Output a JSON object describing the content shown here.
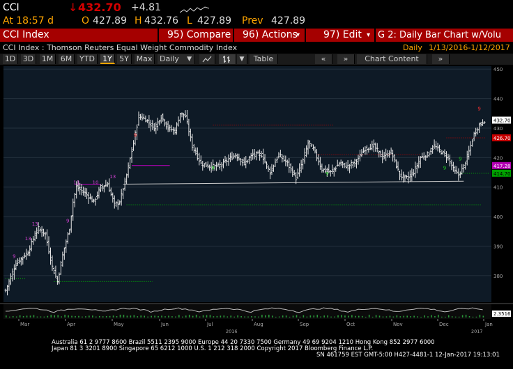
{
  "quote": {
    "ticker": "CCI",
    "arrow": "↓",
    "last": "432.70",
    "change": "+4.81",
    "time_label": "At 18:57 d",
    "open_label": "O",
    "open": "427.89",
    "high_label": "H",
    "high": "432.76",
    "low_label": "L",
    "low": "427.89",
    "prev_label": "Prev",
    "prev": "427.89"
  },
  "menubar": {
    "security": "CCI Index",
    "compare": "95) Compare",
    "actions": "96) Actions",
    "edit": "97) Edit",
    "chart_title": "G 2: Daily Bar Chart w/Volu"
  },
  "subtitle": {
    "text": "CCI Index : Thomson Reuters Equal Weight Commodity Index",
    "frequency": "Daily",
    "range": "1/13/2016-1/12/2017"
  },
  "toolbar": {
    "periods": [
      "1D",
      "3D",
      "1M",
      "6M",
      "YTD",
      "1Y",
      "5Y",
      "Max"
    ],
    "active_period": "1Y",
    "frequency": "Daily",
    "table_label": "Table",
    "chart_content_label": "Chart Content"
  },
  "colors": {
    "background": "#000000",
    "plot_bg": "#0e1a26",
    "bars": "#e6e6e6",
    "menubar": "#a50000",
    "last_price_tag": "#ffffff",
    "red_tag": "#c80000",
    "magenta_tag": "#b400b4",
    "green_tag": "#00a000",
    "accent": "#ffa500"
  },
  "footer": {
    "line1": "Australia 61 2 9777 8600  Brazil 5511 2395 9000  Europe 44 20 7330 7500  Germany 49 69 9204 1210  Hong Kong 852 2977 6000",
    "line2": "Japan 81 3 3201 8900        Singapore 65 6212 1000        U.S. 1 212 318 2000          Copyright 2017 Bloomberg Finance L.P.",
    "line3": "SN 461759 EST  GMT-5:00 H427-4481-1 12-Jan-2017 19:13:01"
  },
  "chart_data": {
    "type": "bar",
    "title": "",
    "xlabel": "",
    "ylabel": "",
    "ylim": [
      371,
      451
    ],
    "y_ticks": [
      "450",
      "440",
      "430",
      "420",
      "410",
      "400",
      "390",
      "380"
    ],
    "x_ticks": [
      "Mar",
      "Apr",
      "May",
      "Jun",
      "Jul",
      "Aug",
      "Sep",
      "Oct",
      "Nov",
      "Dec",
      "Jan"
    ],
    "year_labels": [
      "2016",
      "2017"
    ],
    "price_tags": [
      {
        "label": "432.70",
        "value": 432.7,
        "color": "white"
      },
      {
        "label": "426.70",
        "value": 426.7,
        "color": "red"
      },
      {
        "label": "417.28",
        "value": 417.3,
        "color": "magenta"
      },
      {
        "label": "414.70",
        "value": 414.7,
        "color": "green"
      }
    ],
    "volume_tag": "2.3516",
    "anchors": [
      [
        0,
        375
      ],
      [
        6,
        384
      ],
      [
        13,
        388
      ],
      [
        17,
        394
      ],
      [
        19,
        396
      ],
      [
        23,
        394
      ],
      [
        27,
        383
      ],
      [
        30,
        378
      ],
      [
        33,
        387
      ],
      [
        37,
        396
      ],
      [
        39,
        405
      ],
      [
        41,
        410
      ],
      [
        46,
        408
      ],
      [
        51,
        405
      ],
      [
        55,
        410
      ],
      [
        59,
        411
      ],
      [
        63,
        404
      ],
      [
        66,
        405
      ],
      [
        70,
        414
      ],
      [
        74,
        425
      ],
      [
        77,
        434
      ],
      [
        81,
        433
      ],
      [
        86,
        430
      ],
      [
        90,
        434
      ],
      [
        94,
        430
      ],
      [
        98,
        429
      ],
      [
        101,
        435
      ],
      [
        104,
        434
      ],
      [
        108,
        424
      ],
      [
        113,
        418
      ],
      [
        118,
        417
      ],
      [
        123,
        417
      ],
      [
        128,
        419
      ],
      [
        133,
        421
      ],
      [
        138,
        418
      ],
      [
        143,
        421
      ],
      [
        148,
        421
      ],
      [
        153,
        415
      ],
      [
        158,
        421
      ],
      [
        163,
        418
      ],
      [
        168,
        413
      ],
      [
        172,
        419
      ],
      [
        175,
        425
      ],
      [
        178,
        423
      ],
      [
        183,
        416
      ],
      [
        188,
        415
      ],
      [
        193,
        418
      ],
      [
        198,
        417
      ],
      [
        203,
        419
      ],
      [
        208,
        423
      ],
      [
        213,
        424
      ],
      [
        218,
        420
      ],
      [
        223,
        422
      ],
      [
        228,
        414
      ],
      [
        232,
        413
      ],
      [
        236,
        415
      ],
      [
        240,
        420
      ],
      [
        244,
        421
      ],
      [
        248,
        424
      ],
      [
        252,
        422
      ],
      [
        256,
        420
      ],
      [
        259,
        416
      ],
      [
        262,
        414
      ],
      [
        265,
        417
      ],
      [
        268,
        422
      ],
      [
        271,
        428
      ],
      [
        274,
        431
      ],
      [
        277,
        432.7
      ]
    ],
    "lines": [
      {
        "kind": "support",
        "style": "solid",
        "color": "#cccccc",
        "from": [
          68,
          411
        ],
        "to": [
          265,
          412
        ]
      },
      {
        "kind": "horizontal",
        "style": "dotted",
        "color": "#c00000",
        "from": [
          120,
          431
        ],
        "to": [
          190,
          431
        ]
      },
      {
        "kind": "horizontal",
        "style": "dotted",
        "color": "#c00000",
        "from": [
          180,
          421
        ],
        "to": [
          240,
          421
        ]
      },
      {
        "kind": "horizontal",
        "style": "dotted",
        "color": "#c00000",
        "from": [
          255,
          426.7
        ],
        "to": [
          278,
          426.7
        ]
      },
      {
        "kind": "horizontal",
        "style": "dotted",
        "color": "#00c000",
        "from": [
          70,
          404
        ],
        "to": [
          275,
          404
        ]
      },
      {
        "kind": "horizontal",
        "style": "dotted",
        "color": "#00c000",
        "from": [
          0,
          379
        ],
        "to": [
          12,
          379
        ]
      },
      {
        "kind": "horizontal",
        "style": "dotted",
        "color": "#00c000",
        "from": [
          28,
          378
        ],
        "to": [
          85,
          378
        ]
      },
      {
        "kind": "horizontal",
        "style": "dotted",
        "color": "#00c000",
        "from": [
          262,
          414.7
        ],
        "to": [
          280,
          414.7
        ]
      },
      {
        "kind": "horizontal",
        "style": "solid",
        "color": "#c000c0",
        "from": [
          40,
          411
        ],
        "to": [
          55,
          411
        ]
      },
      {
        "kind": "horizontal",
        "style": "solid",
        "color": "#c000c0",
        "from": [
          73,
          417.3
        ],
        "to": [
          95,
          417.3
        ]
      }
    ],
    "countdown_labels": [
      {
        "text": "9",
        "x": 5,
        "y": 386,
        "color": "magenta"
      },
      {
        "text": "13",
        "x": 13,
        "y": 392,
        "color": "magenta"
      },
      {
        "text": "13",
        "x": 17,
        "y": 397,
        "color": "magenta"
      },
      {
        "text": "9",
        "x": 36,
        "y": 398,
        "color": "magenta"
      },
      {
        "text": "13",
        "x": 41,
        "y": 411,
        "color": "magenta"
      },
      {
        "text": "10",
        "x": 52,
        "y": 411,
        "color": "magenta"
      },
      {
        "text": "13",
        "x": 62,
        "y": 413,
        "color": "magenta"
      },
      {
        "text": "9",
        "x": 75,
        "y": 427,
        "color": "red"
      },
      {
        "text": "9",
        "x": 274,
        "y": 436,
        "color": "red"
      },
      {
        "text": "9",
        "x": 120,
        "y": 416,
        "color": "green"
      },
      {
        "text": "9",
        "x": 186,
        "y": 414,
        "color": "green"
      },
      {
        "text": "9",
        "x": 254,
        "y": 416,
        "color": "green"
      },
      {
        "text": "9",
        "x": 263,
        "y": 419,
        "color": "green"
      }
    ]
  }
}
